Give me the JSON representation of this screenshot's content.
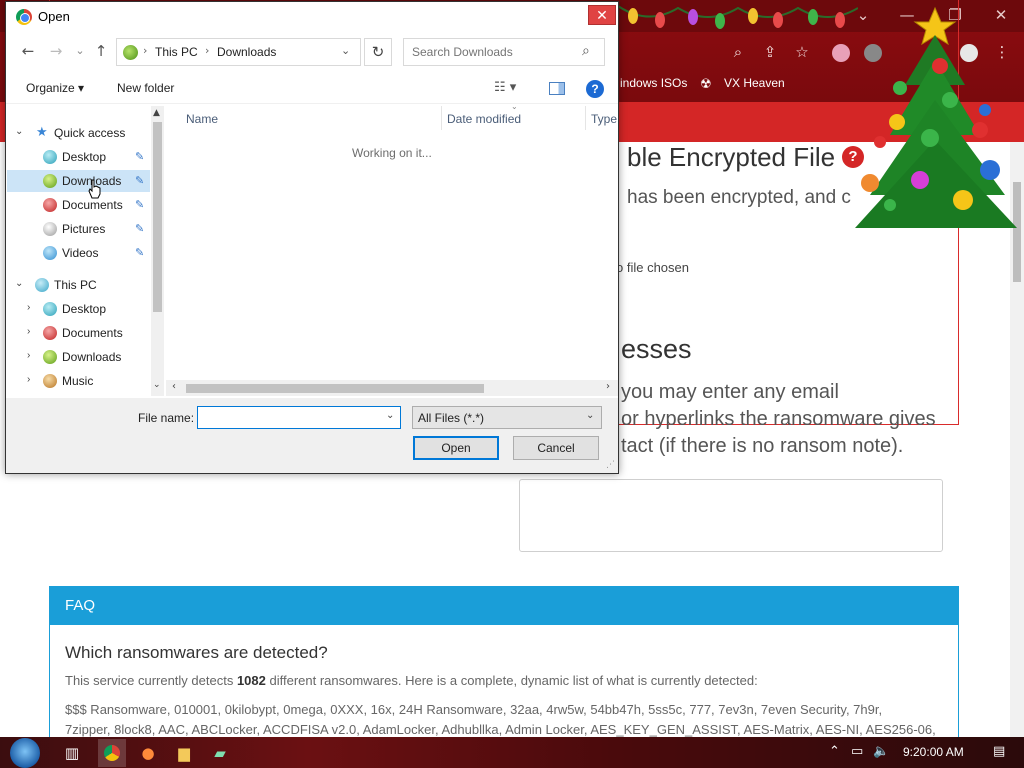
{
  "dialog": {
    "title": "Open",
    "close_icon": "close-icon",
    "nav": {
      "back_icon": "←",
      "forward_icon": "→",
      "recent_icon": "⌄",
      "up_icon": "↑",
      "breadcrumbs": [
        "This PC",
        "Downloads"
      ],
      "refresh_icon": "↻",
      "search_placeholder": "Search Downloads"
    },
    "commands": {
      "organize": "Organize ▾",
      "new_folder": "New folder",
      "help": "?"
    },
    "tree": [
      {
        "label": "Quick access",
        "icon": "star-icon",
        "expanded": true,
        "level": 0
      },
      {
        "label": "Desktop",
        "icon": "desktop-icon",
        "pinned": true,
        "level": 1
      },
      {
        "label": "Downloads",
        "icon": "downloads-icon",
        "pinned": true,
        "level": 1,
        "selected": true
      },
      {
        "label": "Documents",
        "icon": "documents-icon",
        "pinned": true,
        "level": 1
      },
      {
        "label": "Pictures",
        "icon": "pictures-icon",
        "pinned": true,
        "level": 1
      },
      {
        "label": "Videos",
        "icon": "videos-icon",
        "pinned": true,
        "level": 1
      },
      {
        "label": "This PC",
        "icon": "this-pc-icon",
        "expanded": true,
        "level": 0
      },
      {
        "label": "Desktop",
        "icon": "desktop-icon",
        "level": 1
      },
      {
        "label": "Documents",
        "icon": "documents-icon",
        "level": 1
      },
      {
        "label": "Downloads",
        "icon": "downloads-icon",
        "level": 1
      },
      {
        "label": "Music",
        "icon": "music-icon",
        "level": 1
      }
    ],
    "columns": [
      "Name",
      "Date modified",
      "Type"
    ],
    "status": "Working on it...",
    "filename_label": "File name:",
    "filename_value": "",
    "filetype": "All Files (*.*)",
    "open_label": "Open",
    "cancel_label": "Cancel"
  },
  "browser": {
    "bookmarks": [
      "indows ISOs",
      "VX Heaven"
    ],
    "accent": "#d42626"
  },
  "page": {
    "heading_fragment": "ble Encrypted File",
    "help_mark": "?",
    "subtext_fragment": "has been encrypted, and c",
    "no_file": "o file chosen",
    "section_fragment": "esses",
    "email_text": [
      "you may enter any email",
      "or hyperlinks the ransomware gives",
      "tact (if there is no ransom note)."
    ],
    "faq": {
      "header": "FAQ",
      "question": "Which ransomwares are detected?",
      "answer_pre": "This service currently detects ",
      "answer_count": "1082",
      "answer_post": " different ransomwares. Here is a complete, dynamic list of what is currently detected:",
      "list_line1": "$$$ Ransomware, 010001, 0kilobypt, 0mega, 0XXX, 16x, 24H Ransomware, 32aa, 4rw5w, 54bb47h, 5ss5c, 777, 7ev3n, 7even Security, 7h9r,",
      "list_line2": "7zipper, 8lock8, AAC, ABCLocker, ACCDFISA v2.0, AdamLocker, Adhubllka, Admin Locker, AES_KEY_GEN_ASSIST, AES-Matrix, AES-NI, AES256-06,"
    },
    "faq_color": "#1a9ed8"
  },
  "taskbar": {
    "clock": "9:20:00 AM"
  }
}
